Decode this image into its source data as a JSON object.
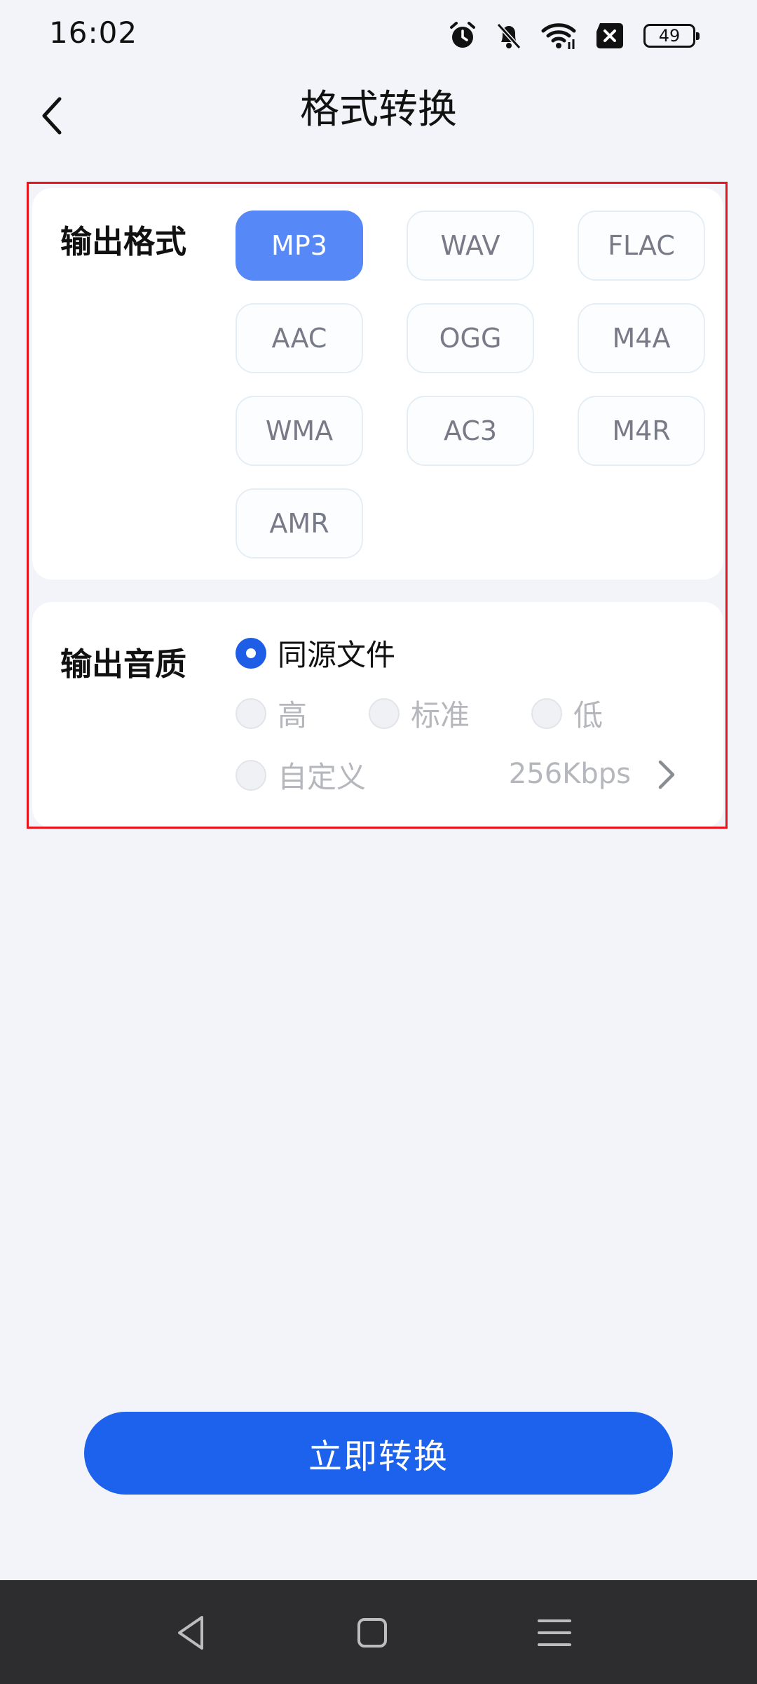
{
  "status_bar": {
    "time": "16:02",
    "battery": "49",
    "icons": [
      "alarm-icon",
      "bell-off-icon",
      "wifi-icon",
      "sim-off-icon",
      "battery-icon"
    ]
  },
  "header": {
    "title": "格式转换",
    "back_icon": "chevron-left-icon"
  },
  "output_format": {
    "label": "输出格式",
    "selected": "MP3",
    "options": [
      "MP3",
      "WAV",
      "FLAC",
      "AAC",
      "OGG",
      "M4A",
      "WMA",
      "AC3",
      "M4R",
      "AMR"
    ]
  },
  "output_quality": {
    "label": "输出音质",
    "selected": "同源文件",
    "options": {
      "same_source": "同源文件",
      "high": "高",
      "standard": "标准",
      "low": "低",
      "custom": "自定义"
    },
    "custom_bitrate": "256Kbps"
  },
  "convert_button": {
    "label": "立即转换"
  },
  "colors": {
    "accent": "#1d62ec",
    "chip_selected": "#5689f7",
    "outline": "#e8141b",
    "background": "#f3f4f9"
  },
  "nav_bar": {
    "icons": [
      "back-triangle-icon",
      "home-square-icon",
      "menu-lines-icon"
    ]
  }
}
